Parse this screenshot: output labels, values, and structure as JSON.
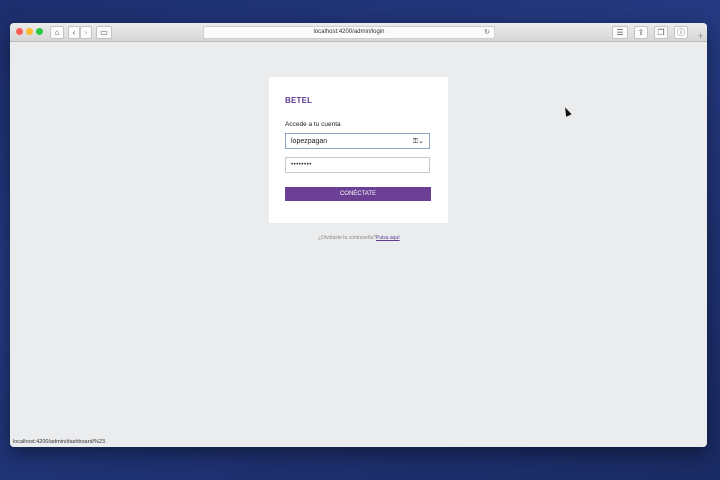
{
  "browser": {
    "url": "localhost:4200/admin/login",
    "status_url": "localhost:4200/admin/dashboard/%23"
  },
  "login": {
    "brand": "BETEL",
    "heading": "Accede a tu cuenta",
    "username_value": "lopezpagan",
    "password_value": "••••••••",
    "submit_label": "CONÉCTATE",
    "forgot_text": "¿Olvidaste la contraseña?",
    "forgot_link": "Pulsa aquí"
  },
  "colors": {
    "brand": "#5e3a8f",
    "button": "#6a3f94"
  },
  "icons": {
    "key": "key-icon",
    "reload": "reload-icon"
  }
}
